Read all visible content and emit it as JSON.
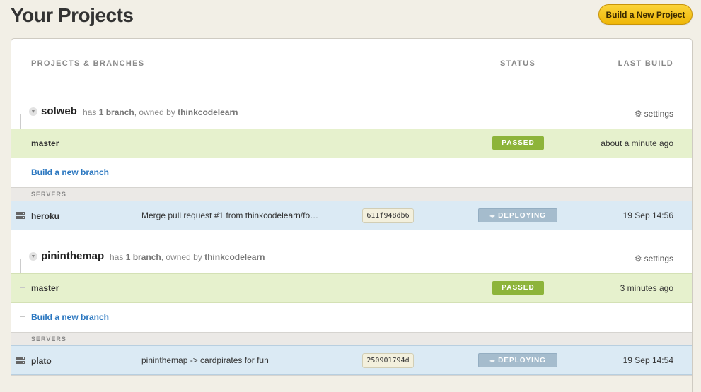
{
  "header": {
    "title": "Your Projects",
    "build_button": "Build a New Project"
  },
  "table": {
    "col_projects": "PROJECTS & BRANCHES",
    "col_status": "STATUS",
    "col_last_build": "LAST BUILD"
  },
  "projects": [
    {
      "name": "solweb",
      "has": "has",
      "branch_count": "1 branch",
      "owned_by": ", owned by",
      "owner": "thinkcodelearn",
      "settings": "settings",
      "branch": {
        "name": "master",
        "status": "PASSED",
        "time": "about a minute ago"
      },
      "new_branch": "Build a new branch",
      "servers_label": "SERVERS",
      "server": {
        "name": "heroku",
        "message": "Merge pull request #1 from thinkcodelearn/fo…",
        "sha": "611f948db6",
        "status": "DEPLOYING",
        "time": "19 Sep 14:56"
      }
    },
    {
      "name": "pininthemap",
      "has": "has",
      "branch_count": "1 branch",
      "owned_by": ", owned by",
      "owner": "thinkcodelearn",
      "settings": "settings",
      "branch": {
        "name": "master",
        "status": "PASSED",
        "time": "3 minutes ago"
      },
      "new_branch": "Build a new branch",
      "servers_label": "SERVERS",
      "server": {
        "name": "plato",
        "message": "pininthemap -> cardpirates for fun",
        "sha": "250901794d",
        "status": "DEPLOYING",
        "time": "19 Sep 14:54"
      }
    }
  ],
  "colors": {
    "passed": "#8db43a",
    "deploying": "#a5bccd",
    "branch_row": "#e6f1cd",
    "server_row": "#dbeaf4",
    "link": "#2b77c0",
    "primary_button": "#f5c51c"
  },
  "icons": [
    "caret-down-icon",
    "gear-icon",
    "server-icon",
    "deploy-arrow-icon"
  ]
}
